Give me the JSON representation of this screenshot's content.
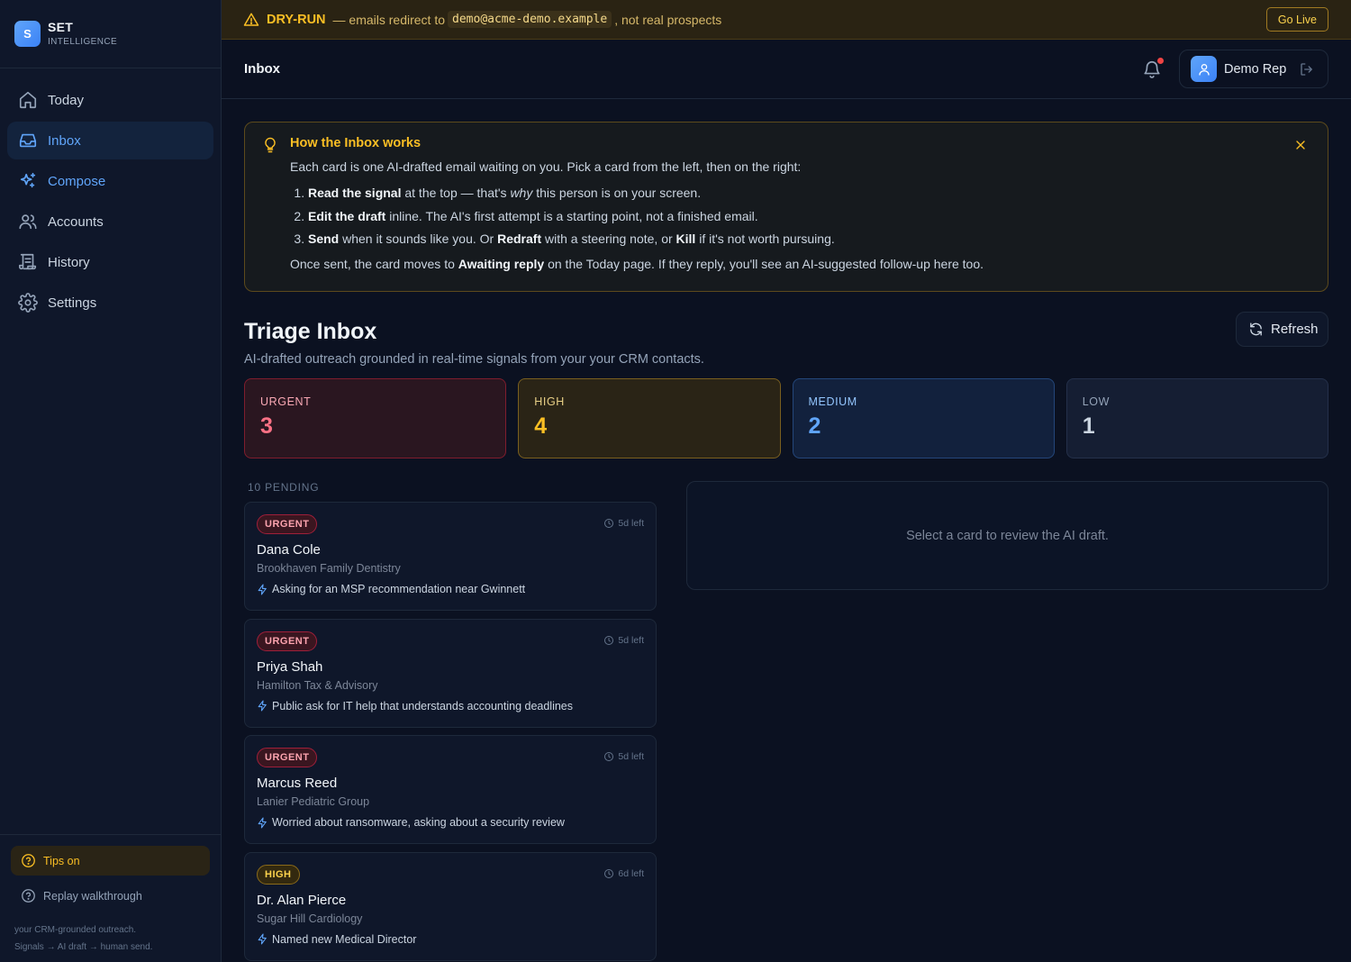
{
  "brand": {
    "logo_letter": "S",
    "name": "SET",
    "subtitle": "INTELLIGENCE"
  },
  "nav": [
    {
      "label": "Today",
      "icon": "home-icon",
      "state": "normal"
    },
    {
      "label": "Inbox",
      "icon": "inbox-icon",
      "state": "active"
    },
    {
      "label": "Compose",
      "icon": "sparkles-icon",
      "state": "accent"
    },
    {
      "label": "Accounts",
      "icon": "users-icon",
      "state": "normal"
    },
    {
      "label": "History",
      "icon": "scroll-icon",
      "state": "normal"
    },
    {
      "label": "Settings",
      "icon": "gear-icon",
      "state": "normal"
    }
  ],
  "sidebar_bottom": {
    "tips_label": "Tips on",
    "replay_label": "Replay walkthrough",
    "footer_line1": "your CRM-grounded outreach.",
    "footer_line2": "Signals → AI draft → human send."
  },
  "banner": {
    "mode": "DRY-RUN",
    "text_before": "— emails redirect to",
    "email": "demo@acme-demo.example",
    "text_after": ", not real prospects",
    "go_live_label": "Go Live"
  },
  "header": {
    "title": "Inbox",
    "user_name": "Demo Rep",
    "has_notification": true
  },
  "howto": {
    "title": "How the Inbox works",
    "intro": "Each card is one AI-drafted email waiting on you. Pick a card from the left, then on the right:",
    "step1_b": "Read the signal",
    "step1_a": " at the top — that's ",
    "step1_i": "why",
    "step1_c": " this person is on your screen.",
    "step2_b": "Edit the draft",
    "step2_a": " inline. The AI's first attempt is a starting point, not a finished email.",
    "step3_b1": "Send",
    "step3_a": " when it sounds like you. Or ",
    "step3_b2": "Redraft",
    "step3_c": " with a steering note, or ",
    "step3_b3": "Kill",
    "step3_d": " if it's not worth pursuing.",
    "foot_a": "Once sent, the card moves to ",
    "foot_b": "Awaiting reply",
    "foot_c": " on the Today page. If they reply, you'll see an AI-suggested follow-up here too."
  },
  "triage": {
    "title": "Triage Inbox",
    "subtitle": "AI-drafted outreach grounded in real-time signals from your your CRM contacts.",
    "refresh_label": "Refresh"
  },
  "stats": [
    {
      "label": "URGENT",
      "value": "3",
      "level": "urgent"
    },
    {
      "label": "HIGH",
      "value": "4",
      "level": "high"
    },
    {
      "label": "MEDIUM",
      "value": "2",
      "level": "medium"
    },
    {
      "label": "LOW",
      "value": "1",
      "level": "low"
    }
  ],
  "pending_label": "10 PENDING",
  "cards": [
    {
      "priority": "URGENT",
      "level": "urgent",
      "time_left": "5d left",
      "name": "Dana Cole",
      "org": "Brookhaven Family Dentistry",
      "signal": "Asking for an MSP recommendation near Gwinnett"
    },
    {
      "priority": "URGENT",
      "level": "urgent",
      "time_left": "5d left",
      "name": "Priya Shah",
      "org": "Hamilton Tax & Advisory",
      "signal": "Public ask for IT help that understands accounting deadlines"
    },
    {
      "priority": "URGENT",
      "level": "urgent",
      "time_left": "5d left",
      "name": "Marcus Reed",
      "org": "Lanier Pediatric Group",
      "signal": "Worried about ransomware, asking about a security review"
    },
    {
      "priority": "HIGH",
      "level": "high",
      "time_left": "6d left",
      "name": "Dr. Alan Pierce",
      "org": "Sugar Hill Cardiology",
      "signal": "Named new Medical Director"
    }
  ],
  "detail_placeholder": "Select a card to review the AI draft."
}
